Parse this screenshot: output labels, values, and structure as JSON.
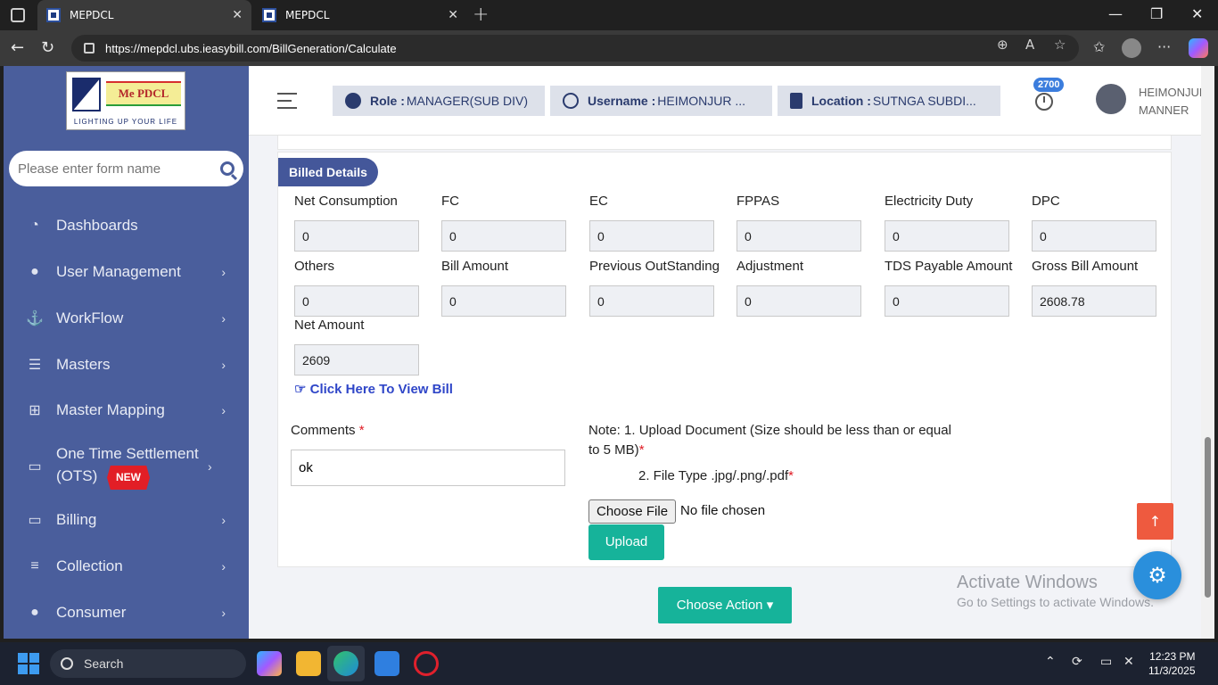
{
  "browser": {
    "tabs": [
      {
        "title": "MEPDCL",
        "active": true
      },
      {
        "title": "MEPDCL",
        "active": false
      }
    ],
    "url": "https://mepdcl.ubs.ieasybill.com/BillGeneration/Calculate"
  },
  "sidebar": {
    "logo": {
      "brand": "Me PDCL",
      "tagline": "LIGHTING UP YOUR LIFE"
    },
    "search_placeholder": "Please enter form name",
    "items": [
      {
        "label": "Dashboards",
        "icon": "dashboard-icon",
        "has_submenu": false
      },
      {
        "label": "User Management",
        "icon": "user-icon",
        "has_submenu": true
      },
      {
        "label": "WorkFlow",
        "icon": "anchor-icon",
        "has_submenu": true
      },
      {
        "label": "Masters",
        "icon": "server-icon",
        "has_submenu": true
      },
      {
        "label": "Master Mapping",
        "icon": "sitemap-icon",
        "has_submenu": true
      },
      {
        "label": "One Time Settlement (OTS)",
        "badge": "NEW",
        "icon": "monitor-icon",
        "has_submenu": true
      },
      {
        "label": "Billing",
        "icon": "monitor-icon",
        "has_submenu": true
      },
      {
        "label": "Collection",
        "icon": "list-icon",
        "has_submenu": true
      },
      {
        "label": "Consumer",
        "icon": "user-icon",
        "has_submenu": true
      }
    ]
  },
  "header": {
    "role_label": "Role :",
    "role_value": "MANAGER(SUB DIV)",
    "username_label": "Username :",
    "username_value": "HEIMONJUR ...",
    "location_label": "Location :",
    "location_value": "SUTNGA SUBDI...",
    "notification_count": "2700",
    "user_name_line1": "HEIMONJUR",
    "user_name_line2": "MANNER"
  },
  "billed_details": {
    "section_title": "Billed Details",
    "fields": [
      {
        "label": "Net Consumption",
        "value": "0"
      },
      {
        "label": "FC",
        "value": "0"
      },
      {
        "label": "EC",
        "value": "0"
      },
      {
        "label": "FPPAS",
        "value": "0"
      },
      {
        "label": "Electricity Duty",
        "value": "0"
      },
      {
        "label": "DPC",
        "value": "0"
      },
      {
        "label": "Others",
        "value": "0"
      },
      {
        "label": "Bill Amount",
        "value": "0"
      },
      {
        "label": "Previous OutStanding",
        "value": "0"
      },
      {
        "label": "Adjustment",
        "value": "0"
      },
      {
        "label": "TDS Payable Amount",
        "value": "0"
      },
      {
        "label": "Gross Bill Amount",
        "value": "2608.78"
      },
      {
        "label": "Net Amount",
        "value": "2609"
      }
    ],
    "view_bill_link": "Click Here To View Bill"
  },
  "comments": {
    "label": "Comments",
    "required": "*",
    "value": "ok"
  },
  "upload": {
    "note_line1": "Note: 1. Upload Document (Size should be less than or equal to 5 MB)",
    "note_line2": "2. File Type .jpg/.png/.pdf",
    "required": "*",
    "choose_file": "Choose File",
    "file_status": "No file chosen",
    "upload_button": "Upload"
  },
  "actions": {
    "choose_action": "Choose Action"
  },
  "watermark": {
    "line1": "Activate Windows",
    "line2": "Go to Settings to activate Windows."
  },
  "taskbar": {
    "search_label": "Search",
    "time": "12:23 PM",
    "date": "11/3/2025"
  }
}
